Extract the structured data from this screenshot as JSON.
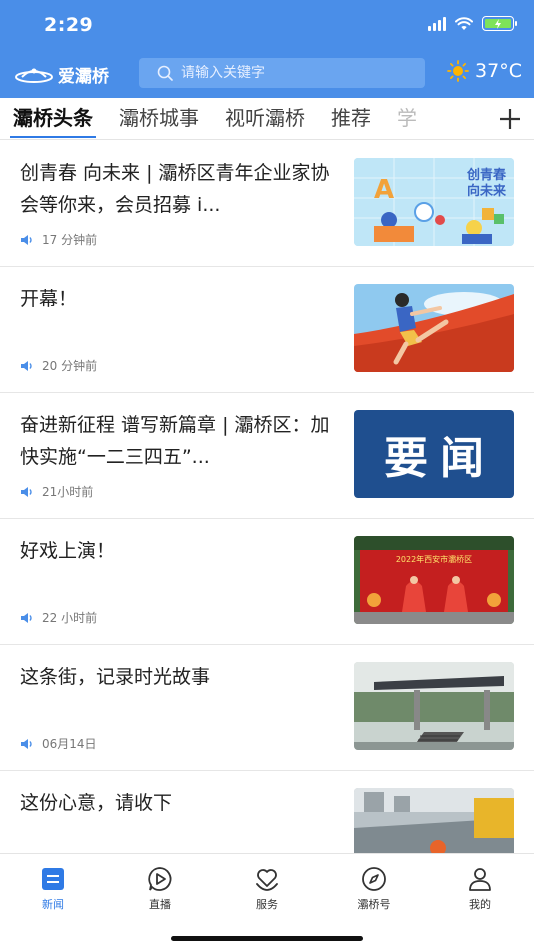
{
  "status_bar": {
    "time": "2:29"
  },
  "header": {
    "logo_text": "爱灞桥",
    "search_placeholder": "请输入关键字",
    "temperature": "37°C",
    "weather_icon": "sun-icon"
  },
  "tabs": [
    {
      "label": "灞桥头条",
      "active": true
    },
    {
      "label": "灞桥城事"
    },
    {
      "label": "视听灞桥"
    },
    {
      "label": "推荐"
    },
    {
      "label": "学"
    }
  ],
  "news": [
    {
      "title": "创青春 向未来 | 灞桥区青年企业家协会等你来，会员招募 i...",
      "time": "17 分钟前",
      "thumb_text": "创青春\n向未来"
    },
    {
      "title": "开幕！",
      "time": "20 分钟前"
    },
    {
      "title": "奋进新征程 谱写新篇章 | 灞桥区：加快实施“一二三四五”...",
      "time": "21小时前",
      "thumb_text": "要闻"
    },
    {
      "title": "好戏上演！",
      "time": "22 小时前",
      "thumb_text": "2022年西安市灞桥区"
    },
    {
      "title": "这条街，记录时光故事",
      "time": "06月14日"
    },
    {
      "title": "这份心意，请收下",
      "time": ""
    }
  ],
  "bottom_nav": [
    {
      "label": "新闻",
      "icon": "news-icon",
      "active": true
    },
    {
      "label": "直播",
      "icon": "live-icon"
    },
    {
      "label": "服务",
      "icon": "service-icon"
    },
    {
      "label": "灞桥号",
      "icon": "compass-icon"
    },
    {
      "label": "我的",
      "icon": "profile-icon"
    }
  ],
  "colors": {
    "brand": "#4a8ee8",
    "accent": "#2f7ae5"
  }
}
